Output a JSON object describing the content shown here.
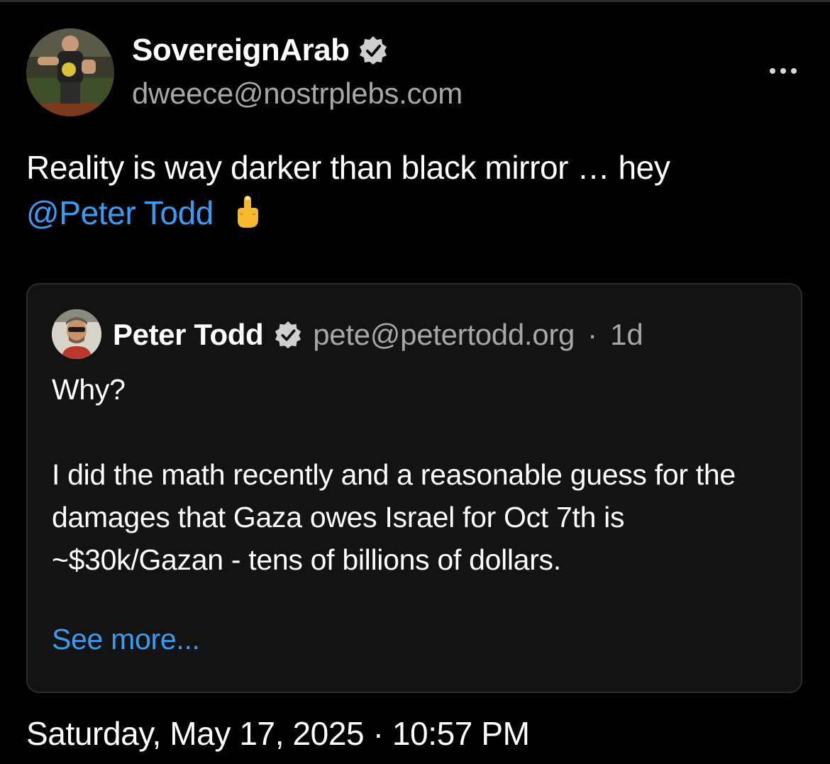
{
  "post": {
    "author": {
      "name": "SovereignArab",
      "handle": "dweece@nostrplebs.com",
      "verified": true
    },
    "text_before_mention": "Reality is way darker than black mirror … hey ",
    "mention": "@Peter Todd",
    "emoji": "middle-finger-icon",
    "more_menu_icon": "more-horizontal-icon",
    "timestamp": "Saturday, May 17, 2025 · 10:57 PM"
  },
  "quote": {
    "author": {
      "name": "Peter Todd",
      "handle": "pete@petertodd.org",
      "verified": true
    },
    "separator": "·",
    "age": "1d",
    "paragraphs": [
      "Why?",
      "I did the math recently and a reasonable guess for the damages that Gaza owes Israel for Oct 7th is ~$30k/Gazan - tens of billions of dollars."
    ],
    "see_more": "See more..."
  },
  "colors": {
    "background": "#000000",
    "card_background": "#131313",
    "link": "#3b9bf0",
    "secondary_text": "#a7a7a7"
  }
}
